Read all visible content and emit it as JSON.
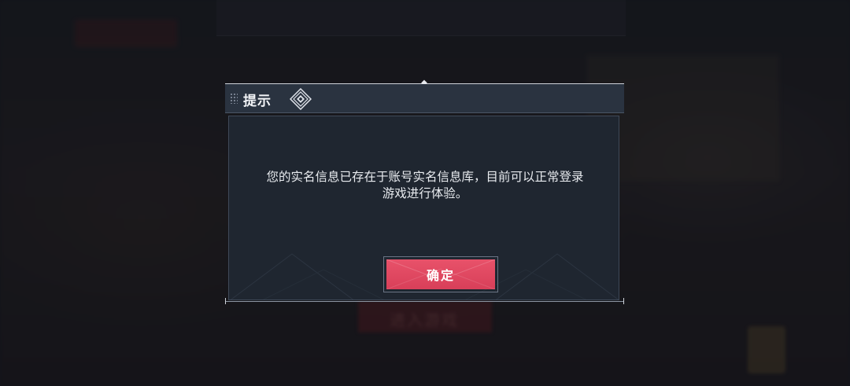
{
  "dialog": {
    "title": "提示",
    "message_line1": "您的实名信息已存在于账号实名信息库，目前可以正常登录",
    "message_line2": "游戏进行体验。",
    "confirm_label": "确定"
  },
  "background": {
    "enter_game_label": "进入游戏"
  },
  "colors": {
    "accent": "#e04a63",
    "dialog_bg": "#1f2630",
    "title_bar_bg": "#2a3340"
  },
  "icons": {
    "title_decoration": "diamond-icon",
    "title_grip": "grip-dots-icon"
  }
}
